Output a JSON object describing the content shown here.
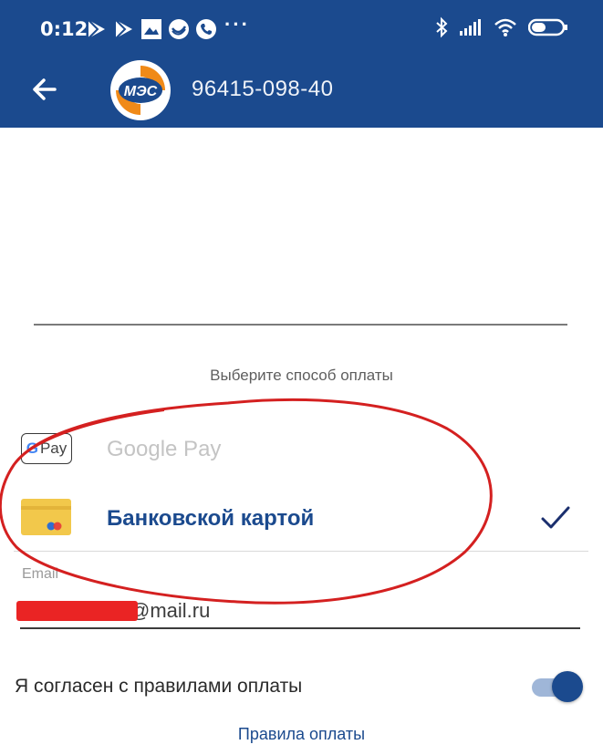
{
  "status_bar": {
    "time": "0:12",
    "more": "···",
    "icons": [
      "play-store-icon",
      "play-store-icon",
      "photo-icon",
      "bank-icon",
      "phone-icon",
      "bluetooth-icon",
      "signal-icon",
      "wifi-icon",
      "battery-icon"
    ]
  },
  "app_bar": {
    "logo_text": "МЭС",
    "title": "96415-098-40"
  },
  "payment": {
    "caption": "Выберите способ оплаты",
    "methods": [
      {
        "badge": "Pay",
        "label": "Google Pay",
        "selected": false
      },
      {
        "label": "Банковской картой",
        "selected": true
      }
    ]
  },
  "email": {
    "label": "Email",
    "value": "@mail.ru"
  },
  "agreement": {
    "label": "Я согласен с правилами оплаты",
    "enabled": true
  },
  "rules_link": "Правила оплаты",
  "colors": {
    "brand": "#1b4a8e",
    "annotation": "#d42020",
    "redaction": "#ea2424"
  }
}
